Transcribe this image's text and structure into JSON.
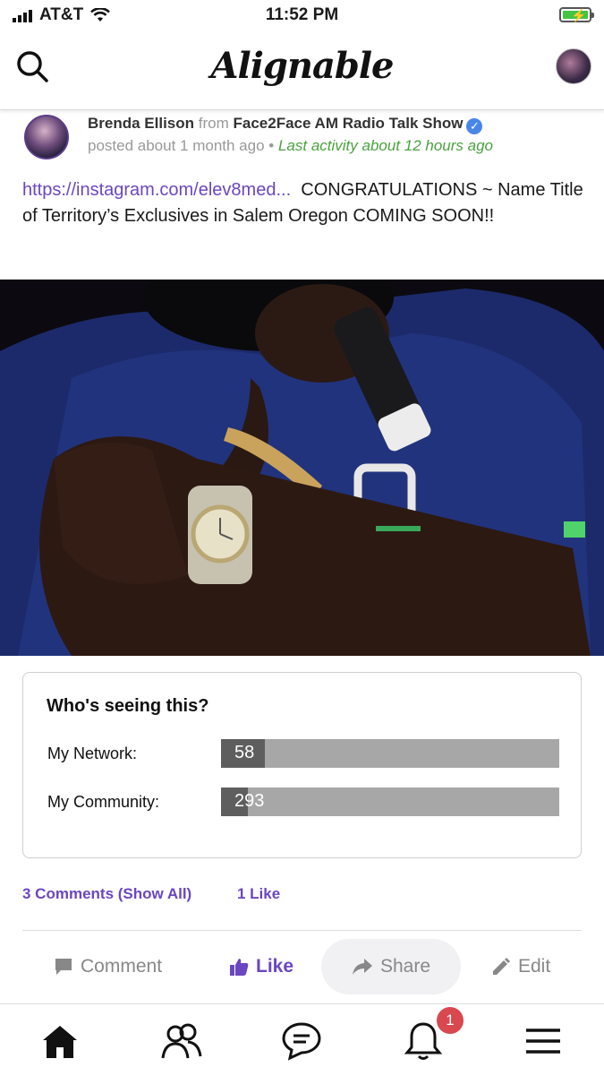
{
  "status_bar": {
    "carrier": "AT&T",
    "time": "11:52 PM"
  },
  "header": {
    "logo": "Alignable"
  },
  "post": {
    "author": "Brenda Ellison",
    "from_label": "from",
    "business": "Face2Face AM Radio Talk Show",
    "posted": "posted about 1 month ago",
    "separator": "•",
    "last_activity": "Last activity about 12 hours ago",
    "link_text": "https://instagram.com/elev8med...",
    "body_text": "CONGRATULATIONS ~ Name Title of Territory’s Exclusives in Salem Oregon COMING SOON!!"
  },
  "seeing": {
    "title": "Who's seeing this?",
    "network_label": "My Network:",
    "network_value": "58",
    "network_fill_fraction": 0.13,
    "community_label": "My Community:",
    "community_value": "293",
    "community_fill_fraction": 0.08
  },
  "counts": {
    "comments": "3 Comments (Show All)",
    "likes": "1 Like"
  },
  "actions": {
    "comment": "Comment",
    "like": "Like",
    "share": "Share",
    "edit": "Edit"
  },
  "bottom_nav": {
    "notification_badge": "1"
  },
  "colors": {
    "accent": "#6b46c1",
    "activity_green": "#4aa23f",
    "badge_red": "#d9474f"
  }
}
